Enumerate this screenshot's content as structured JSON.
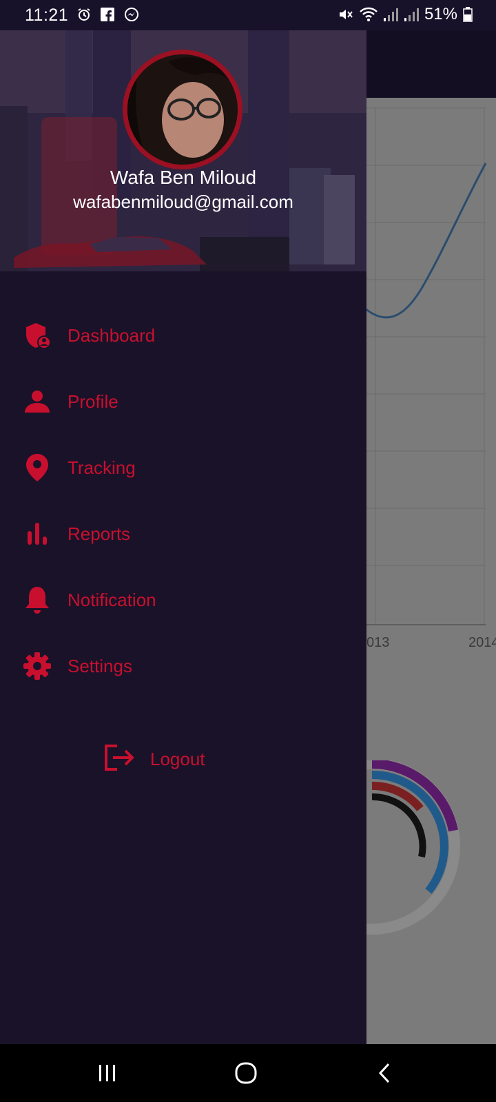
{
  "status_bar": {
    "time": "11:21",
    "battery": "51%",
    "left_icons": [
      "alarm-icon",
      "facebook-icon",
      "messenger-icon"
    ],
    "right_icons": [
      "mute-icon",
      "wifi-icon",
      "signal-icon",
      "signal-icon",
      "battery-icon"
    ]
  },
  "drawer": {
    "user": {
      "name": "Wafa Ben Miloud",
      "email": "wafabenmiloud@gmail.com"
    },
    "menu": [
      {
        "label": "Dashboard",
        "icon": "shield-user-icon"
      },
      {
        "label": "Profile",
        "icon": "person-icon"
      },
      {
        "label": "Tracking",
        "icon": "location-pin-icon"
      },
      {
        "label": "Reports",
        "icon": "bar-chart-icon"
      },
      {
        "label": "Notification",
        "icon": "bell-icon"
      },
      {
        "label": "Settings",
        "icon": "gear-icon"
      }
    ],
    "logout": {
      "label": "Logout",
      "icon": "logout-icon"
    }
  },
  "background": {
    "chart_ticks": [
      "013",
      "2014"
    ]
  },
  "colors": {
    "accent": "#c8102e",
    "drawer_bg": "#1a1229",
    "status_bg": "#17112a"
  }
}
